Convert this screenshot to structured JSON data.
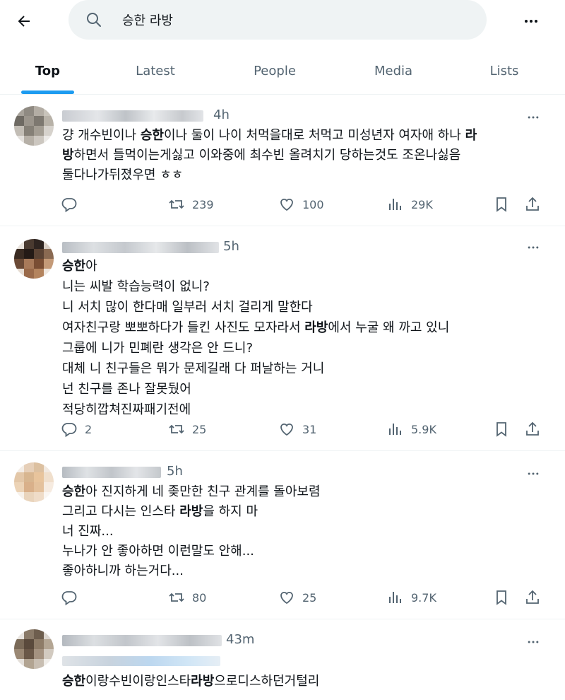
{
  "search": {
    "query": "승한 라방"
  },
  "tabs": [
    "Top",
    "Latest",
    "People",
    "Media",
    "Lists"
  ],
  "tweets": [
    {
      "time": "4h",
      "text_parts": [
        {
          "t": "걍 개수빈이나 "
        },
        {
          "t": "승한",
          "b": true
        },
        {
          "t": "이나 둘이 나이 처먹을대로 처먹고 미성년자 여자애 하나 "
        },
        {
          "t": "라\n방",
          "b": true
        },
        {
          "t": "하면서 들먹이는게싫고 이와중에 최수빈 올려치기 당하는것도 조온나싫음\n둘다나가뒤졌우면 ㅎㅎ"
        }
      ],
      "reply": "",
      "retweet": "239",
      "like": "100",
      "views": "29K"
    },
    {
      "time": "5h",
      "text_parts": [
        {
          "t": "승한",
          "b": true
        },
        {
          "t": "아\n니는 씨발 학습능력이 없니?\n니 서치 많이 한다매 일부러 서치 걸리게 말한다\n여자친구랑 뽀뽀하다가 들킨 사진도 모자라서 "
        },
        {
          "t": "라방",
          "b": true
        },
        {
          "t": "에서 누굴 왜 까고 있니\n그룹에 니가 민폐란 생각은 안 드니?\n대체 니 친구들은 뭐가 문제길래 다 퍼날하는 거니\n넌 친구를 존나 잘못뒀어\n적당히깝쳐진짜패기전에"
        }
      ],
      "reply": "2",
      "retweet": "25",
      "like": "31",
      "views": "5.9K"
    },
    {
      "time": "5h",
      "text_parts": [
        {
          "t": "승한",
          "b": true
        },
        {
          "t": "아 진지하게 네 좆만한 친구 관계를 돌아보렴\n그리고 다시는 인스타 "
        },
        {
          "t": "라방",
          "b": true
        },
        {
          "t": "을 하지 마\n너 진짜...\n누나가 안 좋아하면 이런말도 안해...\n좋아하니까 하는거다..."
        }
      ],
      "reply": "",
      "retweet": "80",
      "like": "25",
      "views": "9.7K"
    },
    {
      "time": "43m",
      "text_parts": [
        {
          "t": "승한",
          "b": true
        },
        {
          "t": "이랑수빈이랑인스타"
        },
        {
          "t": "라방",
          "b": true
        },
        {
          "t": "으로디스하던거털리"
        }
      ],
      "reply": "",
      "retweet": "",
      "like": "",
      "views": ""
    }
  ],
  "icons": [
    "back-arrow-icon",
    "search-icon",
    "more-icon",
    "reply-icon",
    "retweet-icon",
    "like-icon",
    "views-icon",
    "bookmark-icon",
    "share-icon"
  ],
  "colors": {
    "accent": "#1d9bf0",
    "text": "#0f1419",
    "secondary": "#536471",
    "search_bg": "#eff3f4"
  }
}
